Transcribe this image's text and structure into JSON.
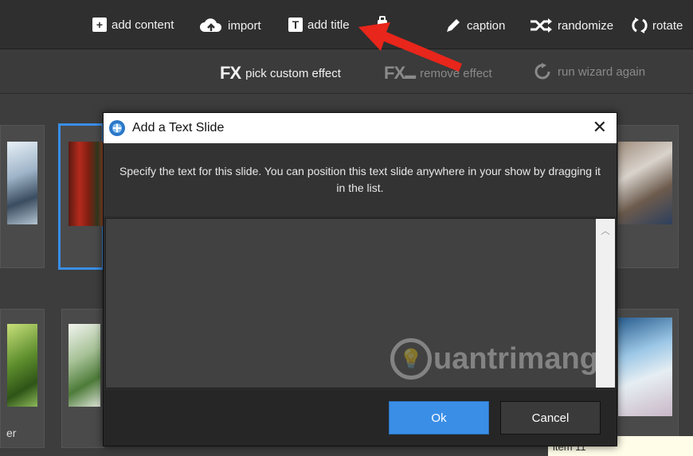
{
  "toolbar": {
    "add_content": "add content",
    "import": "import",
    "add_title": "add title",
    "caption": "caption",
    "randomize": "randomize",
    "rotate": "rotate"
  },
  "effects_bar": {
    "pick_custom_effect": "pick custom effect",
    "remove_effect": "remove effect",
    "run_wizard_again": "run wizard again"
  },
  "dialog": {
    "title": "Add a Text Slide",
    "message": "Specify the text for this slide. You can position this text slide anywhere in your show by dragging it in the list.",
    "text_value": "",
    "ok_label": "Ok",
    "cancel_label": "Cancel"
  },
  "grid": {
    "bottom_left_label": "er",
    "item_label": "item 11"
  },
  "watermark": {
    "text": "uantrimang"
  },
  "colors": {
    "accent_blue": "#3a8ee6",
    "selection_border": "#3a8ee6",
    "arrow_red": "#e8261b"
  }
}
